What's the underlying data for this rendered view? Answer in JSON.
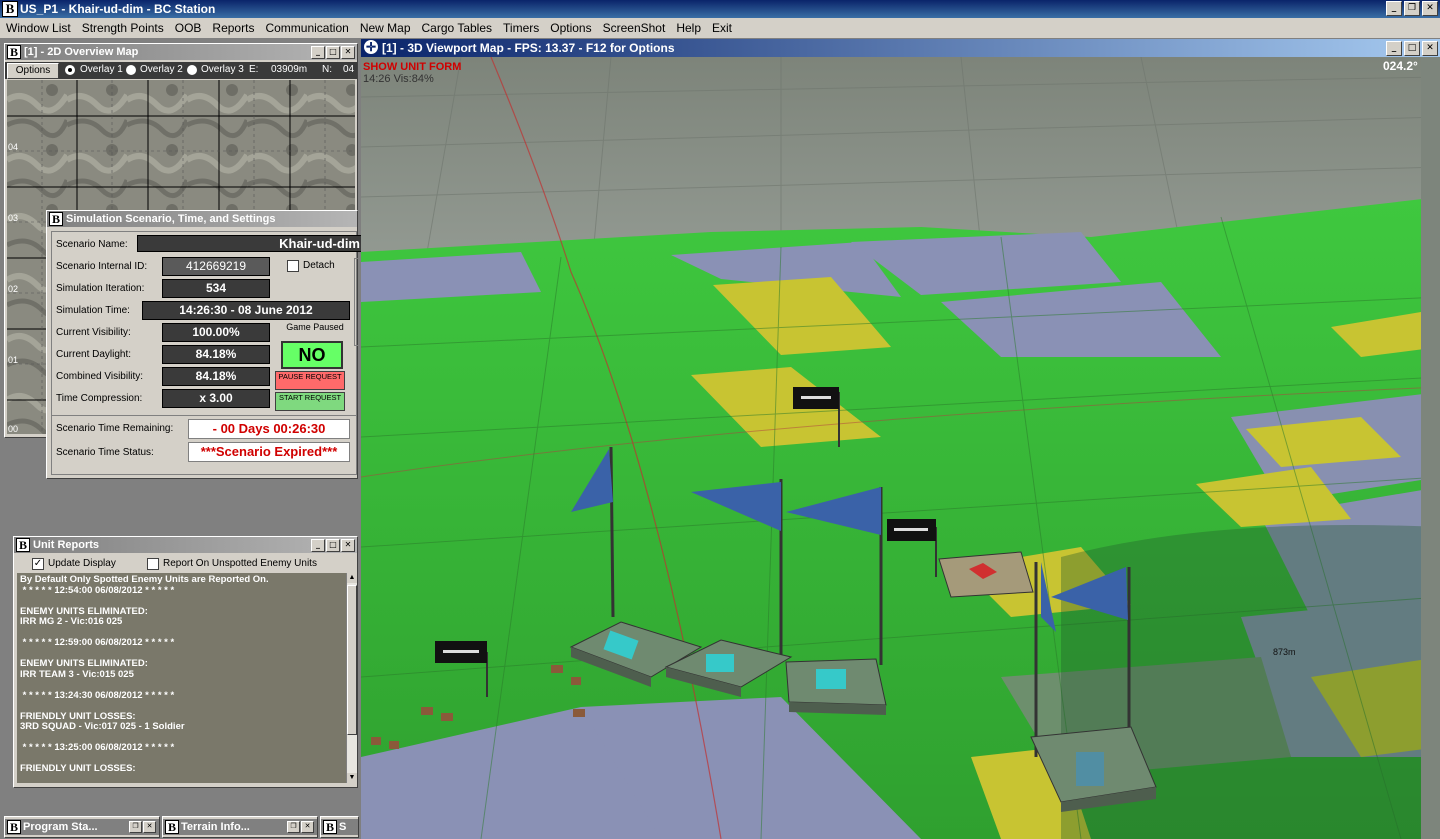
{
  "window": {
    "title": "US_P1 - Khair-ud-dim - BC Station"
  },
  "menu": [
    "Window List",
    "Strength Points",
    "OOB",
    "Reports",
    "Communication",
    "New Map",
    "Cargo Tables",
    "Timers",
    "Options",
    "ScreenShot",
    "Help",
    "Exit"
  ],
  "overview": {
    "title": "[1] - 2D Overview Map",
    "options_label": "Options",
    "overlays": [
      "Overlay 1",
      "Overlay 2",
      "Overlay 3"
    ],
    "e_label": "E:",
    "e_value": "03909m",
    "n_label": "N:",
    "n_value": "04",
    "grid_labels": [
      "04",
      "03",
      "02",
      "01",
      "00"
    ]
  },
  "scenario": {
    "title": "Simulation Scenario, Time, and Settings",
    "name_label": "Scenario Name:",
    "name": "Khair-ud-dim",
    "id_label": "Scenario Internal ID:",
    "id": "412669219",
    "detach_label": "Detach",
    "iter_label": "Simulation Iteration:",
    "iteration": "534",
    "time_label": "Simulation Time:",
    "time": "14:26:30 - 08 June 2012",
    "vis_label": "Current Visibility:",
    "visibility": "100.00%",
    "day_label": "Current Daylight:",
    "daylight": "84.18%",
    "comb_label": "Combined Visibility:",
    "combined": "84.18%",
    "comp_label": "Time Compression:",
    "compression": "x 3.00",
    "paused_label": "Game Paused",
    "paused": "NO",
    "pause_btn": "PAUSE REQUEST",
    "start_btn": "START REQUEST",
    "remain_label": "Scenario Time Remaining:",
    "remaining": "- 00 Days 00:26:30",
    "status_label": "Scenario Time Status:",
    "status": "***Scenario Expired***"
  },
  "reports": {
    "title": "Unit Reports",
    "update_label": "Update Display",
    "unspotted_label": "Report On Unspotted Enemy Units",
    "lines": [
      "By Default Only Spotted Enemy Units are Reported On.",
      " * * * * * 12:54:00 06/08/2012 * * * * *",
      "",
      "ENEMY UNITS ELIMINATED:",
      "IRR MG 2 - Vic:016 025",
      "",
      " * * * * * 12:59:00 06/08/2012 * * * * *",
      "",
      "ENEMY UNITS ELIMINATED:",
      "IRR TEAM 3 - Vic:015 025",
      "",
      " * * * * * 13:24:30 06/08/2012 * * * * *",
      "",
      "FRIENDLY UNIT LOSSES:",
      "3RD SQUAD - Vic:017 025 - 1 Soldier",
      "",
      " * * * * * 13:25:00 06/08/2012 * * * * *",
      "",
      "FRIENDLY UNIT LOSSES:"
    ]
  },
  "viewport": {
    "title": "[1] - 3D Viewport Map - FPS: 13.37 - F12 for Options",
    "show_unit_form": "SHOW UNIT FORM",
    "time_vis": "14:26 Vis:84%",
    "heading": "024.2°",
    "distance": "873m"
  },
  "taskbar": [
    "Program Sta...",
    "Terrain Info...",
    "S"
  ]
}
